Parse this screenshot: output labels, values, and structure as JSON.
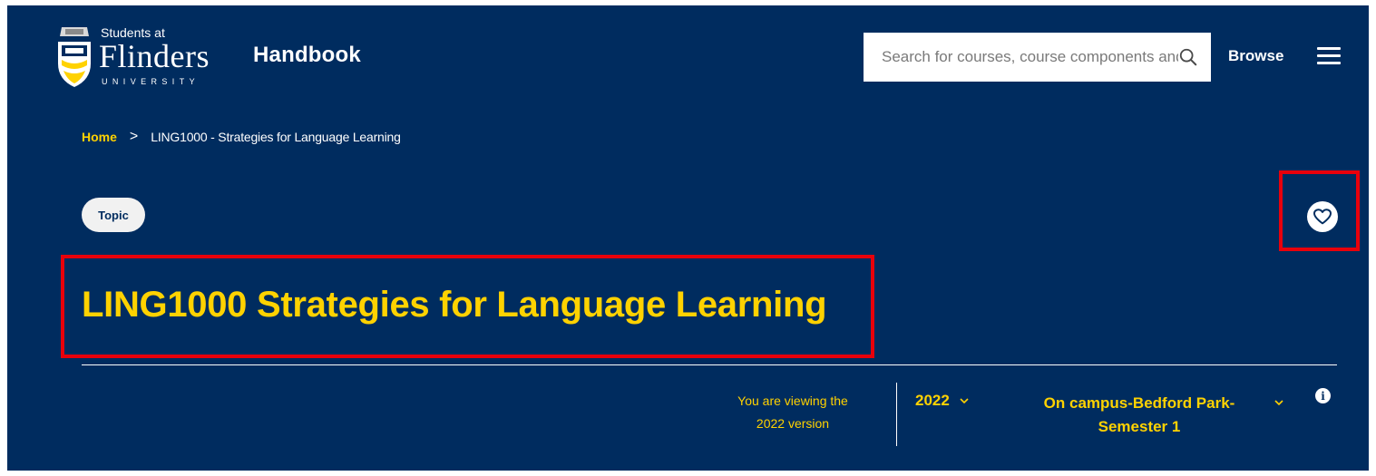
{
  "header": {
    "logo": {
      "line1": "Students at",
      "line2": "Flinders",
      "line3": "UNIVERSITY"
    },
    "app_title": "Handbook",
    "search": {
      "placeholder": "Search for courses, course components and topics",
      "icon": "search-icon"
    },
    "browse_label": "Browse",
    "menu_icon": "hamburger-menu-icon"
  },
  "breadcrumb": {
    "home": "Home",
    "separator": ">",
    "current": "LING1000 - Strategies for Language Learning"
  },
  "badge": "Topic",
  "favourite_icon": "heart-icon",
  "page_title": "LING1000 Strategies for Language Learning",
  "version_bar": {
    "viewing_line1": "You are viewing the",
    "viewing_line2": "2022 version",
    "year": "2022",
    "campus_line1": "On campus-Bedford Park-",
    "campus_line2": "Semester 1",
    "info_symbol": "i"
  },
  "colors": {
    "background": "#002c5f",
    "accent_yellow": "#ffd200",
    "highlight_red": "#e8000b",
    "white": "#ffffff"
  }
}
